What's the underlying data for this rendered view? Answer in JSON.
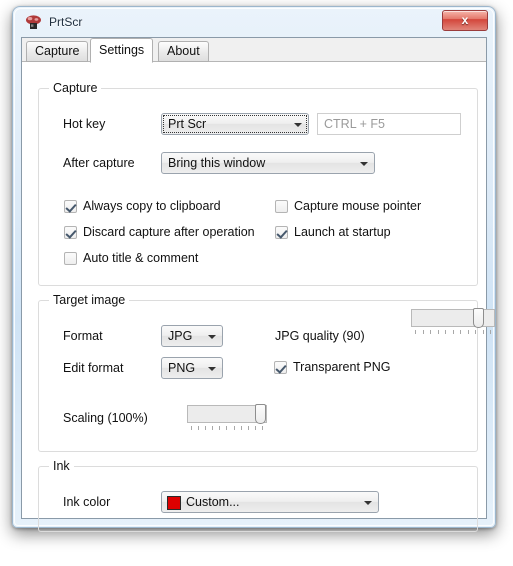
{
  "window": {
    "title": "PrtScr",
    "icon": "app-mushroom-icon",
    "close_label": "x"
  },
  "tabs": [
    {
      "id": "capture",
      "label": "Capture",
      "active": false
    },
    {
      "id": "settings",
      "label": "Settings",
      "active": true
    },
    {
      "id": "about",
      "label": "About",
      "active": false
    }
  ],
  "capture_group": {
    "title": "Capture",
    "hotkey_label": "Hot key",
    "hotkey_value": "Prt Scr",
    "hotkey_custom_value": "CTRL + F5",
    "after_capture_label": "After capture",
    "after_capture_value": "Bring this window",
    "checkboxes": [
      {
        "label": "Always copy to clipboard",
        "checked": true
      },
      {
        "label": "Capture mouse pointer",
        "checked": false
      },
      {
        "label": "Discard capture after operation",
        "checked": true
      },
      {
        "label": "Launch at startup",
        "checked": true
      },
      {
        "label": "Auto title & comment",
        "checked": false
      }
    ]
  },
  "target_group": {
    "title": "Target image",
    "format_label": "Format",
    "format_value": "JPG",
    "edit_format_label": "Edit format",
    "edit_format_value": "PNG",
    "jpg_quality_label": "JPG quality (90)",
    "jpg_quality_value": 90,
    "transparent_png_label": "Transparent PNG",
    "transparent_png_checked": true,
    "scaling_label": "Scaling (100%)",
    "scaling_value": 100
  },
  "ink_group": {
    "title": "Ink",
    "ink_color_label": "Ink color",
    "ink_color_value": "Custom...",
    "ink_color_swatch": "#DD0000"
  }
}
